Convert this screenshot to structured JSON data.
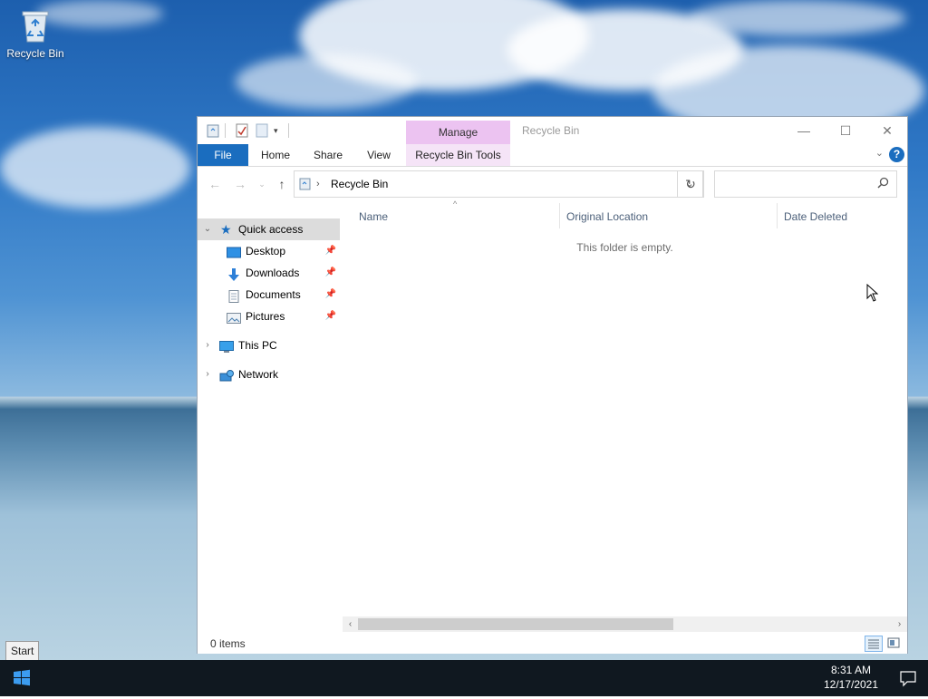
{
  "desktop": {
    "icons": [
      {
        "label": "Recycle Bin"
      }
    ]
  },
  "window": {
    "title": "Recycle Bin",
    "context_group": "Manage",
    "ribbon_tabs": [
      "File",
      "Home",
      "Share",
      "View",
      "Recycle Bin Tools"
    ],
    "address": {
      "path": [
        "Recycle Bin"
      ]
    },
    "search": {
      "placeholder": ""
    },
    "nav_pane": {
      "quick_access": {
        "label": "Quick access",
        "items": [
          {
            "label": "Desktop",
            "icon": "desktop-icon",
            "pinned": true
          },
          {
            "label": "Downloads",
            "icon": "download-arrow-icon",
            "pinned": true
          },
          {
            "label": "Documents",
            "icon": "document-icon",
            "pinned": true
          },
          {
            "label": "Pictures",
            "icon": "pictures-icon",
            "pinned": true
          }
        ]
      },
      "this_pc": {
        "label": "This PC"
      },
      "network": {
        "label": "Network"
      }
    },
    "columns": [
      "Name",
      "Original Location",
      "Date Deleted"
    ],
    "empty_message": "This folder is empty.",
    "status": "0 items",
    "colors": {
      "accent": "#1a6dbf",
      "manage_tab": "#ecc3f1"
    }
  },
  "taskbar": {
    "start_tooltip": "Start",
    "time": "8:31 AM",
    "date": "12/17/2021"
  }
}
